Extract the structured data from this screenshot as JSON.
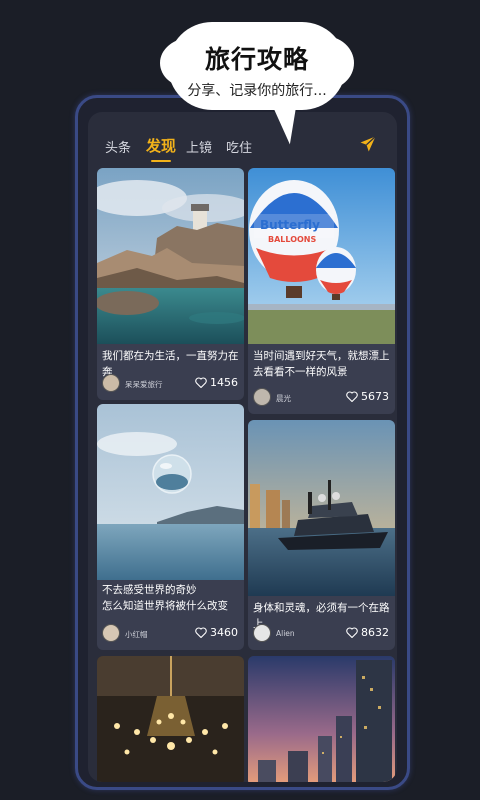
{
  "promo": {
    "title": "旅行攻略",
    "subtitle": "分享、记录你的旅行..."
  },
  "tabs": [
    {
      "label": "头条",
      "active": false
    },
    {
      "label": "发现",
      "active": true
    },
    {
      "label": "上镜",
      "active": false
    },
    {
      "label": "吃住",
      "active": false
    }
  ],
  "colors": {
    "accent": "#f2b21a",
    "background": "#1b1e27",
    "card": "#3a3e50"
  },
  "icons": {
    "send": "paper-plane-icon",
    "like": "heart-icon"
  },
  "cards": [
    {
      "caption": "我们都在为生活，一直努力在奔",
      "author": "呆呆爱旅行",
      "likes": "1456"
    },
    {
      "caption": "当时间遇到好天气，就想漂上去看看不一样的风景",
      "author": "晨光",
      "likes": "5673"
    },
    {
      "caption": "不去感受世界的奇妙\n怎么知道世界将被什么改变",
      "author": "小红帽",
      "likes": "3460"
    },
    {
      "caption": "身体和灵魂，必须有一个在路上",
      "author": "Alien",
      "likes": "8632"
    },
    {
      "caption": "",
      "author": "",
      "likes": ""
    },
    {
      "caption": "",
      "author": "",
      "likes": ""
    }
  ]
}
